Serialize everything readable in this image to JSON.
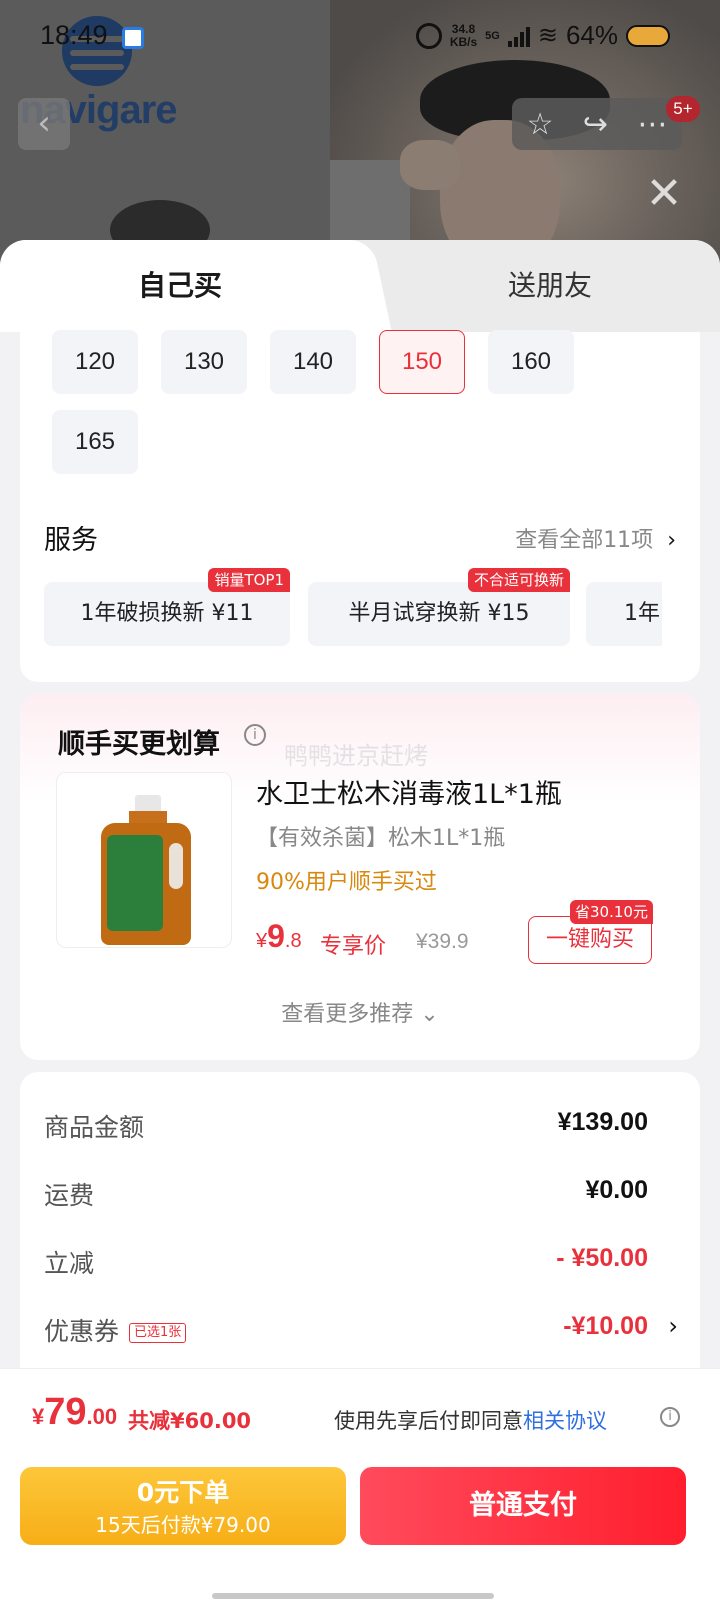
{
  "status_bar": {
    "time": "18:49",
    "net_speed": "34.8",
    "net_unit": "KB/s",
    "network": "5G",
    "battery": "64%"
  },
  "brand": {
    "logo_text": "navigare"
  },
  "cart_badge": "5+",
  "tabs": {
    "self": "自己买",
    "gift": "送朋友"
  },
  "sizes": [
    "120",
    "130",
    "140",
    "150",
    "160",
    "165"
  ],
  "selected_size": "150",
  "service": {
    "title": "服务",
    "view_all": "查看全部11项",
    "items": [
      {
        "label": "1年破损换新  ¥11",
        "tag": "销量TOP1"
      },
      {
        "label": "半月试穿换新  ¥15",
        "tag": "不合适可换新"
      },
      {
        "label": "1年[",
        "tag": ""
      }
    ]
  },
  "recommend": {
    "title": "顺手买更划算",
    "watermark": "鸭鸭进京赶烤",
    "product_name": "水卫士松木消毒液1L*1瓶",
    "spec": "【有效杀菌】松木1L*1瓶",
    "users": "90%用户顺手买过",
    "price_currency": "¥",
    "price_int": "9",
    "price_dec": ".8",
    "price_label": "专享价",
    "original_price": "¥39.9",
    "save_tag": "省30.10元",
    "buy_button": "一键购买",
    "more": "查看更多推荐"
  },
  "summary": {
    "rows": [
      {
        "label": "商品金额",
        "value": "¥139.00"
      },
      {
        "label": "运费",
        "value": "¥0.00"
      },
      {
        "label": "立减",
        "value": "- ¥50.00"
      },
      {
        "label": "优惠券",
        "tag": "已选1张",
        "value": "-¥10.00"
      }
    ]
  },
  "bottom": {
    "currency": "¥",
    "total_int": "79",
    "total_dec": ".00",
    "total_saved": "共减¥60.00",
    "agree_text": "使用先享后付即同意",
    "agree_link": "相关协议",
    "later_title": "0元下单",
    "later_sub": "15天后付款¥79.00",
    "pay_button": "普通支付"
  },
  "colors": {
    "accent": "#e8313b",
    "warning": "#f7ae17",
    "link": "#2f6fe0"
  }
}
